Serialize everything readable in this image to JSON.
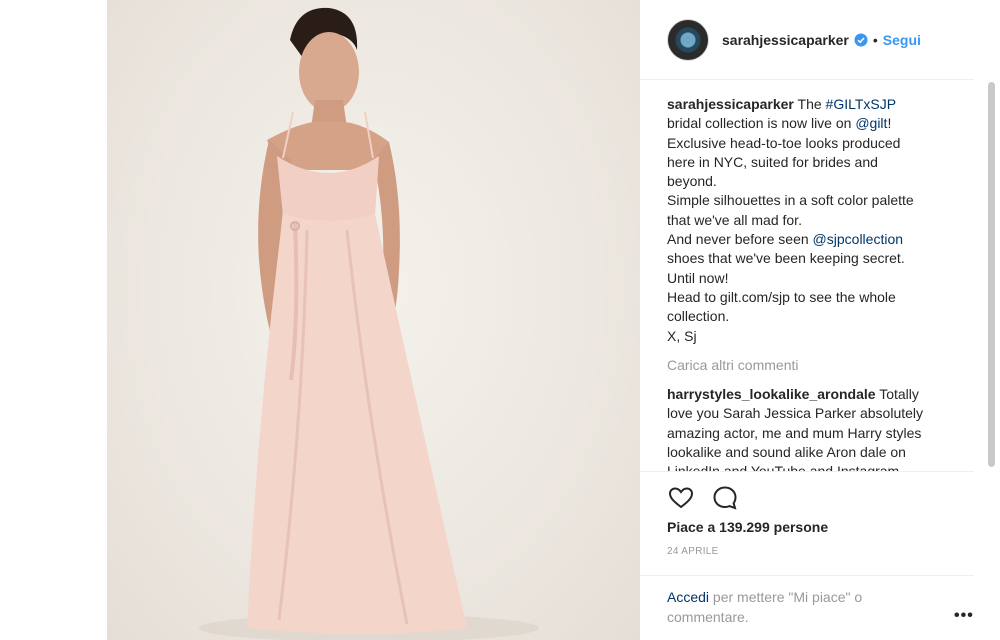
{
  "post": {
    "username": "sarahjessicaparker",
    "follow_label": "Segui",
    "separator": "•"
  },
  "caption": {
    "username": "sarahjessicaparker",
    "text_1": " The ",
    "hashtag": "#GILTxSJP",
    "line_2a": "bridal collection is now live on ",
    "mention_gilt": "@gilt",
    "line_2b": "!",
    "line_3": "Exclusive head-to-toe looks produced",
    "line_4": "here in NYC, suited for brides and",
    "line_5": "beyond.",
    "line_6": "Simple silhouettes in a soft color palette",
    "line_7": "that we've all mad for.",
    "line_8a": "And never before seen ",
    "mention_sjp": "@sjpcollection",
    "line_9": "shoes that we've been keeping secret.",
    "line_10": "Until now!",
    "line_11": "Head to gilt.com/sjp to see the whole",
    "line_12": "collection.",
    "line_13": "X, Sj"
  },
  "load_more_label": "Carica altri commenti",
  "comment": {
    "username": "harrystyles_lookalike_arondale",
    "line_1": " Totally",
    "line_2": "love you Sarah Jessica Parker absolutely",
    "line_3": "amazing actor, me and mum Harry styles",
    "line_4": "lookalike and sound alike Aron dale on",
    "line_5": "LinkedIn and YouTube and Instagram"
  },
  "icons": {
    "like": "heart-icon",
    "comment": "comment-bubble-icon",
    "more": "more-options-icon",
    "verified": "verified-badge-icon"
  },
  "likes_label": "Piace a 139.299 persone",
  "date_label": "24 APRILE",
  "login": {
    "link": "Accedi",
    "rest": " per mettere \"Mi piace\" o commentare."
  },
  "more_label": "•••",
  "colors": {
    "link_blue": "#3897f0",
    "tag_navy": "#003569",
    "muted_gray": "#999999",
    "dress_pink": "#f2cfc4"
  }
}
